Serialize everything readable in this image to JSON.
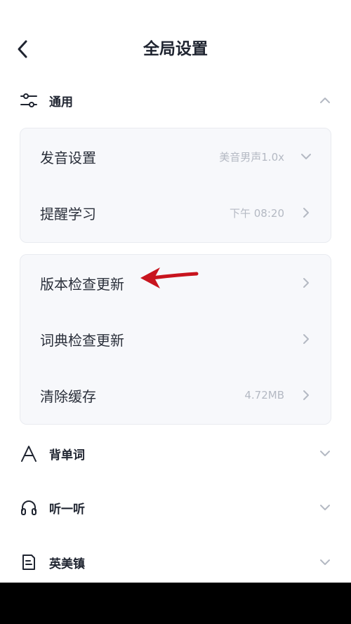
{
  "header": {
    "title": "全局设置"
  },
  "sections": {
    "general": {
      "label": "通用"
    },
    "vocab": {
      "label": "背单词"
    },
    "listen": {
      "label": "听一听"
    },
    "town": {
      "label": "英美镇"
    }
  },
  "card1": {
    "rows": [
      {
        "label": "发音设置",
        "value": "美音男声1.0x"
      },
      {
        "label": "提醒学习",
        "value": "下午 08:20"
      }
    ]
  },
  "card2": {
    "rows": [
      {
        "label": "版本检查更新",
        "value": ""
      },
      {
        "label": "词典检查更新",
        "value": ""
      },
      {
        "label": "清除缓存",
        "value": "4.72MB"
      }
    ]
  },
  "icons": {
    "back": "chevron-left-icon",
    "general": "sliders-icon",
    "vocab": "letter-a-icon",
    "listen": "headphones-icon",
    "town": "document-icon"
  },
  "colors": {
    "annotation_arrow": "#c8141e",
    "card_bg": "#f7f8fb",
    "muted_text": "#b4b9c3"
  }
}
